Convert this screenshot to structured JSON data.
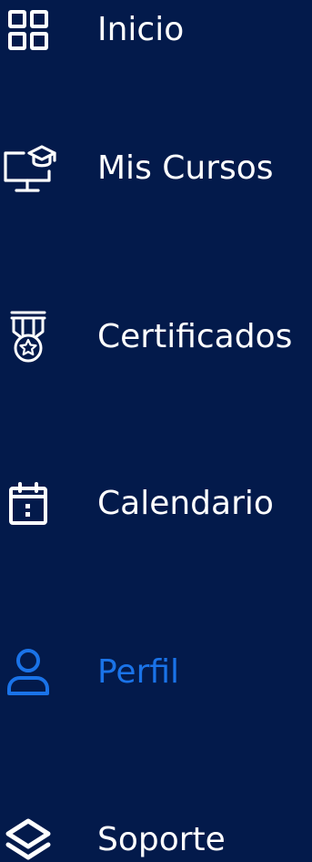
{
  "colors": {
    "background": "#031A4B",
    "text": "#FFFFFF",
    "accent": "#1A73E8"
  },
  "nav": {
    "items": [
      {
        "label": "Inicio",
        "icon": "grid-icon",
        "active": false
      },
      {
        "label": "Mis Cursos",
        "icon": "monitor-graduation-cap-icon",
        "active": false
      },
      {
        "label": "Certificados",
        "icon": "medal-star-icon",
        "active": false
      },
      {
        "label": "Calendario",
        "icon": "calendar-icon",
        "active": false
      },
      {
        "label": "Perfil",
        "icon": "user-icon",
        "active": true
      },
      {
        "label": "Soporte",
        "icon": "layers-icon",
        "active": false
      }
    ]
  }
}
